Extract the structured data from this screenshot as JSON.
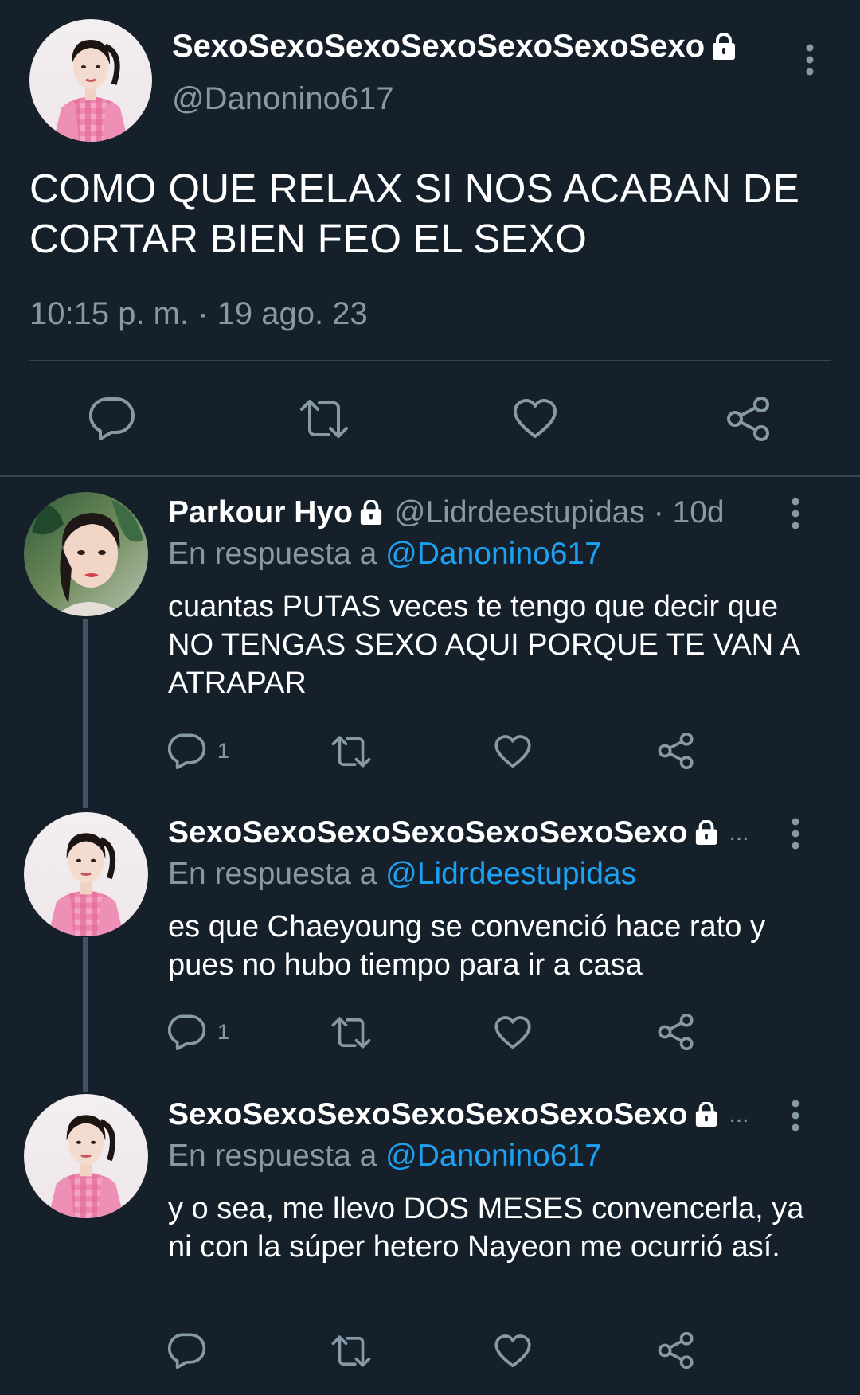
{
  "main_tweet": {
    "display_name": "SexoSexoSexoSexoSexoSexoSexo",
    "handle": "@Danonino617",
    "text": "COMO QUE RELAX SI NOS ACABAN DE CORTAR BIEN FEO EL SEXO",
    "timestamp": "10:15 p. m. · 19 ago. 23"
  },
  "replies": [
    {
      "display_name": "Parkour Hyo",
      "handle": "@Lidrdeestupidas · 10d",
      "reply_to_label": "En respuesta a ",
      "reply_to_handle": "@Danonino617",
      "text": "cuantas PUTAS veces te tengo que decir que NO TENGAS SEXO AQUI PORQUE TE VAN A ATRAPAR",
      "reply_count": "1"
    },
    {
      "display_name": "SexoSexoSexoSexoSexoSexoSexo",
      "handle_truncated": "...",
      "reply_to_label": "En respuesta a ",
      "reply_to_handle": "@Lidrdeestupidas",
      "text": "es que Chaeyoung se convenció hace rato y pues no hubo tiempo para ir a casa",
      "reply_count": "1"
    },
    {
      "display_name": "SexoSexoSexoSexoSexoSexoSexo",
      "handle_truncated": "...",
      "reply_to_label": "En respuesta a ",
      "reply_to_handle": "@Danonino617",
      "text": "y o sea, me llevo DOS MESES convencerla, ya ni con la súper hetero Nayeon me ocurrió así.",
      "reply_count": ""
    }
  ],
  "icons": {
    "reply": "reply-icon",
    "retweet": "retweet-icon",
    "like": "like-icon",
    "share": "share-icon",
    "more": "more-vertical-icon",
    "lock": "lock-icon"
  },
  "colors": {
    "background": "#15202b",
    "secondary_text": "#8899a6",
    "link": "#1da1f2",
    "divider": "#38444d",
    "avatar_pink": "#e58fb2"
  }
}
